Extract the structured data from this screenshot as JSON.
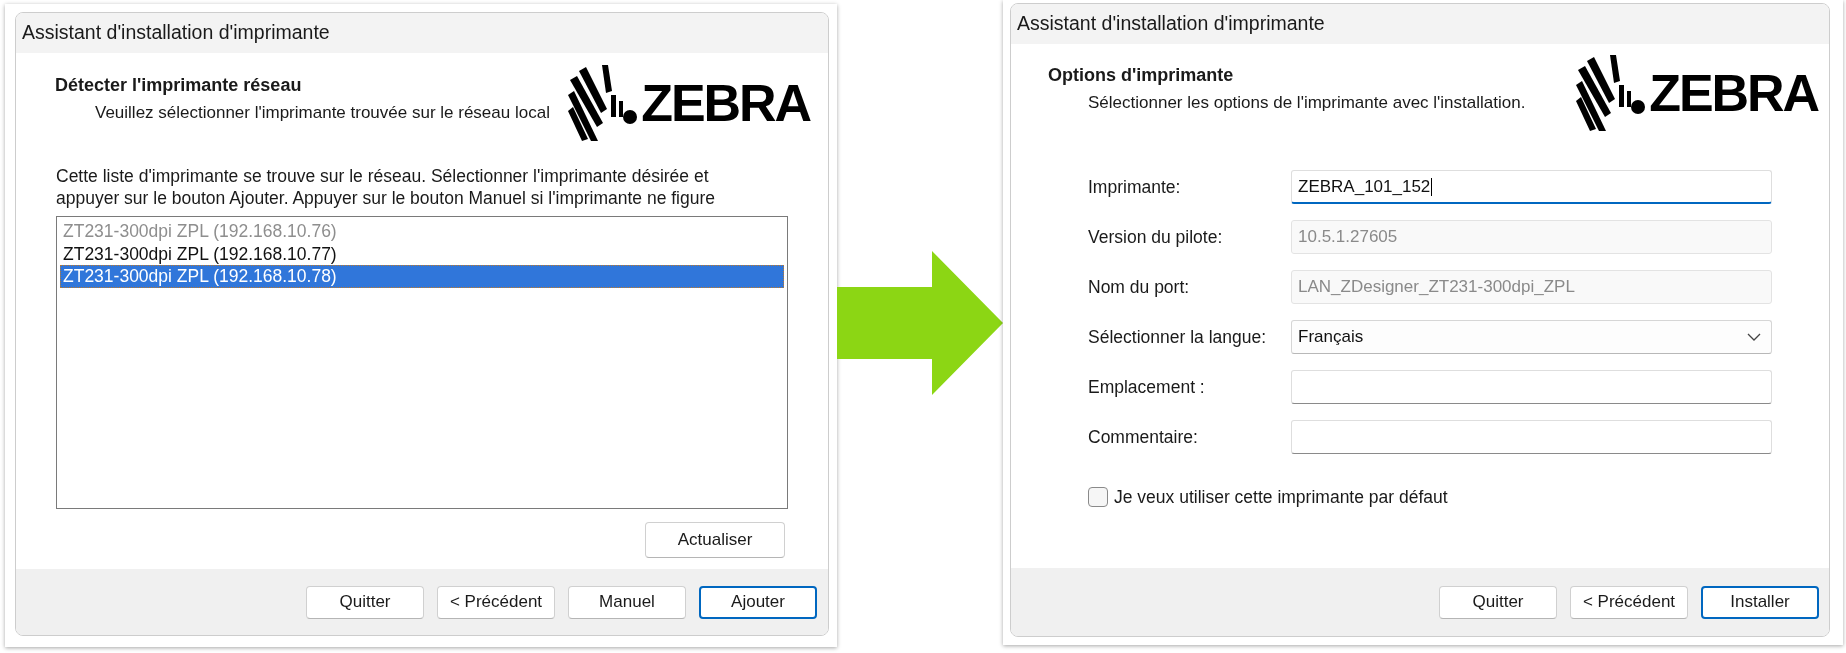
{
  "dialogs": [
    {
      "kind": "printer_list",
      "title": "Assistant d'installation d'imprimante",
      "heading": "Détecter l'imprimante réseau",
      "subtitle": "Veuillez sélectionner l'imprimante trouvée sur le réseau local",
      "logo": {
        "text": "ZEBRA"
      },
      "description_lines": [
        "Cette liste d'imprimante se trouve sur le réseau. Sélectionner l'imprimante désirée et",
        "appuyer sur le bouton Ajouter. Appuyer sur le bouton Manuel si l'imprimante ne figure"
      ],
      "printers": [
        {
          "label": "ZT231-300dpi ZPL (192.168.10.76)",
          "selected": false,
          "disabled": true
        },
        {
          "label": "ZT231-300dpi ZPL (192.168.10.77)",
          "selected": false,
          "disabled": false
        },
        {
          "label": "ZT231-300dpi ZPL (192.168.10.78)",
          "selected": true,
          "disabled": false
        }
      ],
      "refresh_button": {
        "label": "Actualiser"
      },
      "buttons": [
        {
          "label": "Quitter",
          "default": false
        },
        {
          "label": "< Précédent",
          "default": false
        },
        {
          "label": "Manuel",
          "default": false
        },
        {
          "label": "Ajouter",
          "default": true
        }
      ]
    },
    {
      "kind": "options_form",
      "title": "Assistant d'installation d'imprimante",
      "heading": "Options d'imprimante",
      "subtitle": "Sélectionner les options de l'imprimante avec l'installation.",
      "logo": {
        "text": "ZEBRA"
      },
      "fields": [
        {
          "kind": "text",
          "label": "Imprimante:",
          "value": "ZEBRA_101_152",
          "focused": true,
          "disabled": false
        },
        {
          "kind": "text",
          "label": "Version du pilote:",
          "value": "10.5.1.27605",
          "focused": false,
          "disabled": true
        },
        {
          "kind": "text",
          "label": "Nom du port:",
          "value": "LAN_ZDesigner_ZT231-300dpi_ZPL",
          "focused": false,
          "disabled": true
        },
        {
          "kind": "select",
          "label": "Sélectionner la langue:",
          "value": "Français",
          "focused": false,
          "disabled": false
        },
        {
          "kind": "text",
          "label": "Emplacement :",
          "focused": false,
          "disabled": false
        },
        {
          "kind": "text",
          "label": "Commentaire:",
          "focused": false,
          "disabled": false
        }
      ],
      "checkbox": {
        "label": "Je veux utiliser cette imprimante par défaut",
        "checked": false
      },
      "buttons": [
        {
          "label": "Quitter",
          "default": false
        },
        {
          "label": "< Précédent",
          "default": false
        },
        {
          "label": "Installer",
          "default": true
        }
      ]
    }
  ]
}
